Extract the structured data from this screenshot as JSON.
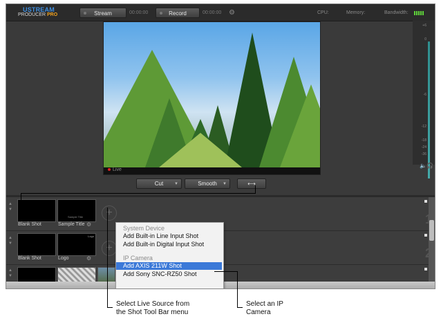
{
  "logo": {
    "top": "USTREAM",
    "bottom": "PRODUCER",
    "pro": "PRO"
  },
  "toolbar": {
    "stream_label": "Stream",
    "stream_time": "00:00:00",
    "record_label": "Record",
    "record_time": "00:00:00",
    "cpu_label": "CPU:",
    "memory_label": "Memory:",
    "bandwidth_label": "Bandwidth:"
  },
  "preview": {
    "status": "Live"
  },
  "meter": {
    "labels": [
      "+6",
      "0",
      "-6",
      "-12",
      "-18",
      "-24",
      "-36"
    ]
  },
  "transition": {
    "cut_label": "Cut",
    "smooth_label": "Smooth",
    "swap_icon": "⟷"
  },
  "rows": [
    {
      "number": "1",
      "shots": [
        {
          "label": "Blank Shot"
        },
        {
          "label": "Sample Title",
          "thumb_text": "Sample Title"
        }
      ]
    },
    {
      "number": "2",
      "shots": [
        {
          "label": "Blank Shot"
        },
        {
          "label": "Logo",
          "thumb_text": "Logo"
        }
      ]
    }
  ],
  "menu": {
    "section1": "System Device",
    "items1": [
      "Add Built-in Line Input Shot",
      "Add Built-in Digital Input Shot"
    ],
    "section2": "IP Camera",
    "items2": [
      "Add AXIS 211W Shot",
      "Add Sony SNC-RZ50 Shot"
    ],
    "selected": "Add AXIS 211W Shot"
  },
  "callouts": {
    "left": [
      "Select Live Source from",
      "the Shot Tool Bar menu"
    ],
    "right": [
      "Select an IP",
      "Camera"
    ]
  },
  "colors": {
    "accent_blue": "#3b79d8",
    "logo_blue": "#3f8fe0",
    "logo_orange": "#f2a31f",
    "bandwidth_green": "#5fd43a"
  }
}
